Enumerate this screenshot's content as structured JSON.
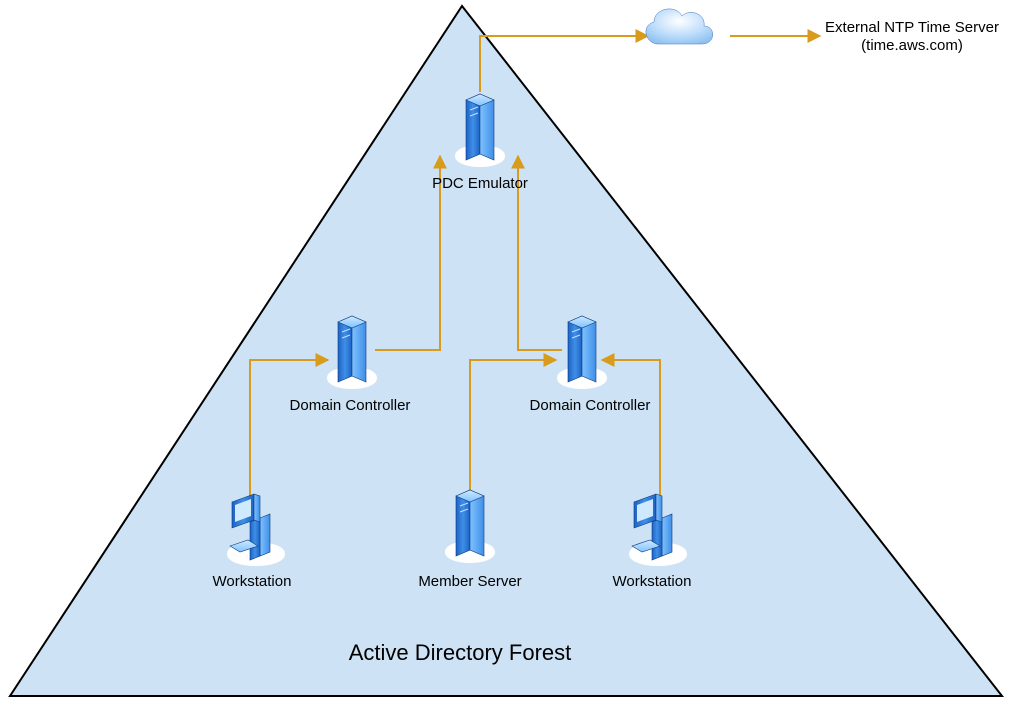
{
  "diagram": {
    "title": "Active Directory Forest",
    "external": {
      "name": "External NTP Time Server",
      "host": "(time.aws.com)"
    },
    "nodes": {
      "pdc": "PDC Emulator",
      "dc_left": "Domain Controller",
      "dc_right": "Domain Controller",
      "ws_left": "Workstation",
      "member": "Member Server",
      "ws_right": "Workstation"
    },
    "colors": {
      "triangle_stroke": "#000000",
      "triangle_fill": "#cde3f5",
      "arrow": "#d89b1b",
      "server_dark": "#1f6fd6",
      "server_light": "#7fc2ff",
      "cloud_fill": "#bcdcfb",
      "cloud_stroke": "#3e7bc4"
    }
  }
}
